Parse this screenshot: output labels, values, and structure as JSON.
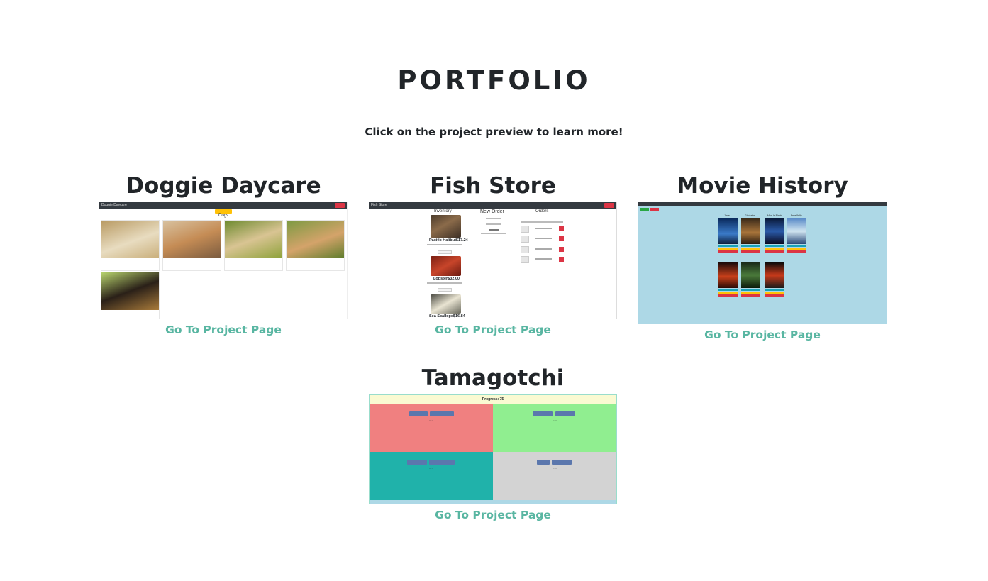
{
  "section": {
    "title": "PORTFOLIO",
    "subtitle": "Click on the project preview to learn more!"
  },
  "projects": [
    {
      "title": "Doggie Daycare",
      "link_label": "Go To Project Page"
    },
    {
      "title": "Fish Store",
      "link_label": "Go To Project Page"
    },
    {
      "title": "Movie History",
      "link_label": "Go To Project Page"
    },
    {
      "title": "Tamagotchi",
      "link_label": "Go To Project Page"
    }
  ],
  "previews": {
    "doggie": {
      "nav_brand": "Doggie Daycare",
      "heading": "Dogs"
    },
    "fish": {
      "nav_brand": "Fish Store",
      "col_inventory": "Inventory",
      "col_new_order": "New Order",
      "col_orders": "Orders",
      "items": [
        "Pacific Halibut$17.24",
        "Lobster$32.00",
        "Sea Scallops$16.84"
      ]
    },
    "movie": {
      "titles": [
        "Jaws",
        "Gladiator",
        "Men In Black",
        "Free Willy"
      ]
    },
    "tamagotchi": {
      "heading": "Progress: 75"
    }
  },
  "colors": {
    "accent": "#59b6a2",
    "divider": "#4fb3a9",
    "text": "#212529"
  }
}
